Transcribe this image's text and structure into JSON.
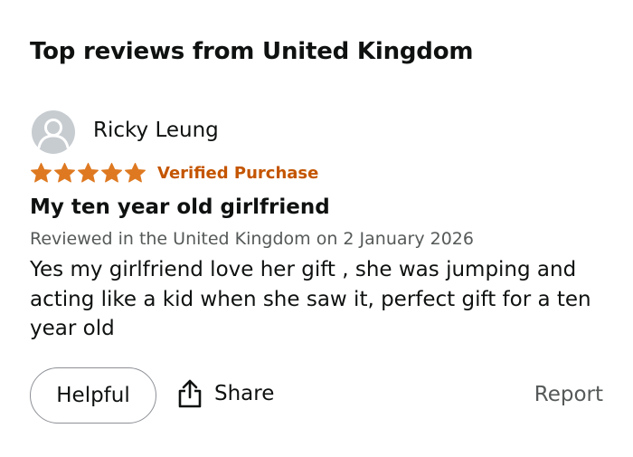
{
  "section": {
    "title": "Top reviews from United Kingdom"
  },
  "review": {
    "reviewer_name": "Ricky Leung",
    "avatar_icon": "user-silhouette-icon",
    "rating": 5,
    "rating_max": 5,
    "star_icon": "star-icon",
    "star_color": "#de7921",
    "verified_label": "Verified Purchase",
    "verified_color": "#c45500",
    "title": "My ten year old girlfriend",
    "meta": "Reviewed in the United Kingdom on 2 January 2026",
    "body": "Yes my girlfriend love her gift , she was jumping and acting like a kid when she saw it, perfect gift for a ten year old"
  },
  "actions": {
    "helpful_label": "Helpful",
    "share_label": "Share",
    "share_icon": "share-icon",
    "report_label": "Report"
  }
}
